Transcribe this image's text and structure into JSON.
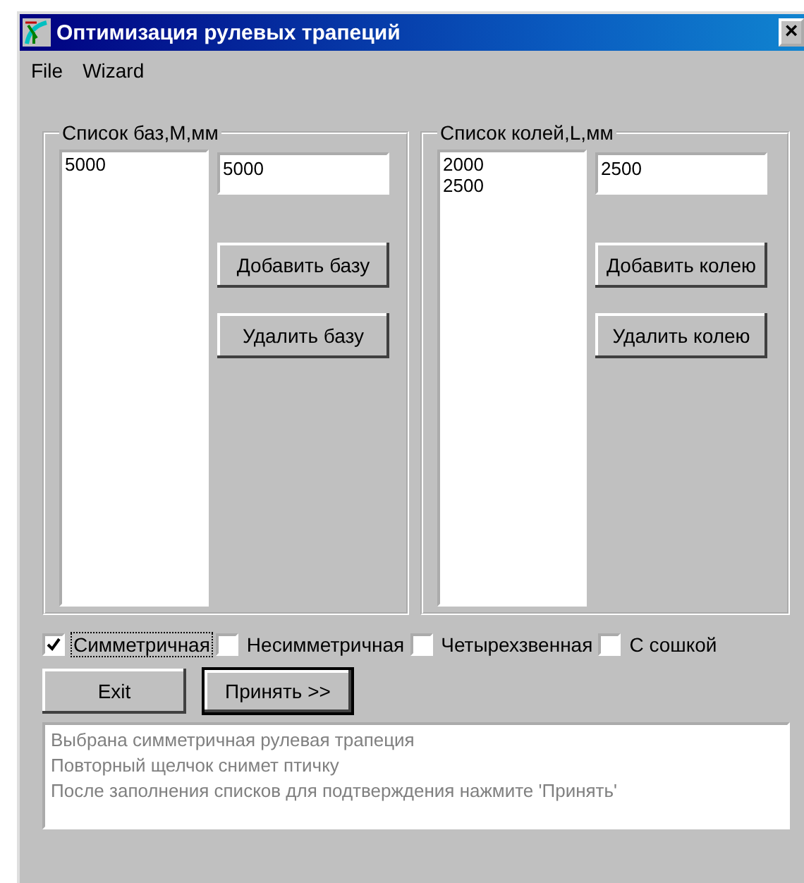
{
  "window": {
    "title": "Оптимизация рулевых трапеций",
    "close": "×"
  },
  "menu": [
    "File",
    "Wizard"
  ],
  "groups": [
    {
      "title": "Список баз,M,мм",
      "list": [
        "5000"
      ],
      "input": "5000",
      "buttons": [
        "Добавить базу",
        "Удалить базу"
      ]
    },
    {
      "title": "Список колей,L,мм",
      "list": [
        "2000",
        "2500"
      ],
      "input": "2500",
      "buttons": [
        "Добавить колею",
        "Удалить колею"
      ]
    }
  ],
  "options": [
    {
      "label": "Симметричная",
      "checked": true,
      "focused": true
    },
    {
      "label": "Несимметричная",
      "checked": false,
      "focused": false
    },
    {
      "label": "Четырехзвенная",
      "checked": false,
      "focused": false
    },
    {
      "label": "С сошкой",
      "checked": false,
      "focused": false
    }
  ],
  "actions": [
    {
      "label": "Exit",
      "default": false
    },
    {
      "label": "Принять >>",
      "default": true
    }
  ],
  "messages": [
    "Выбрана симметричная рулевая трапеция",
    "Повторный щелчок снимет птичку",
    "После заполнения списков для подтверждения нажмите 'Принять'"
  ]
}
